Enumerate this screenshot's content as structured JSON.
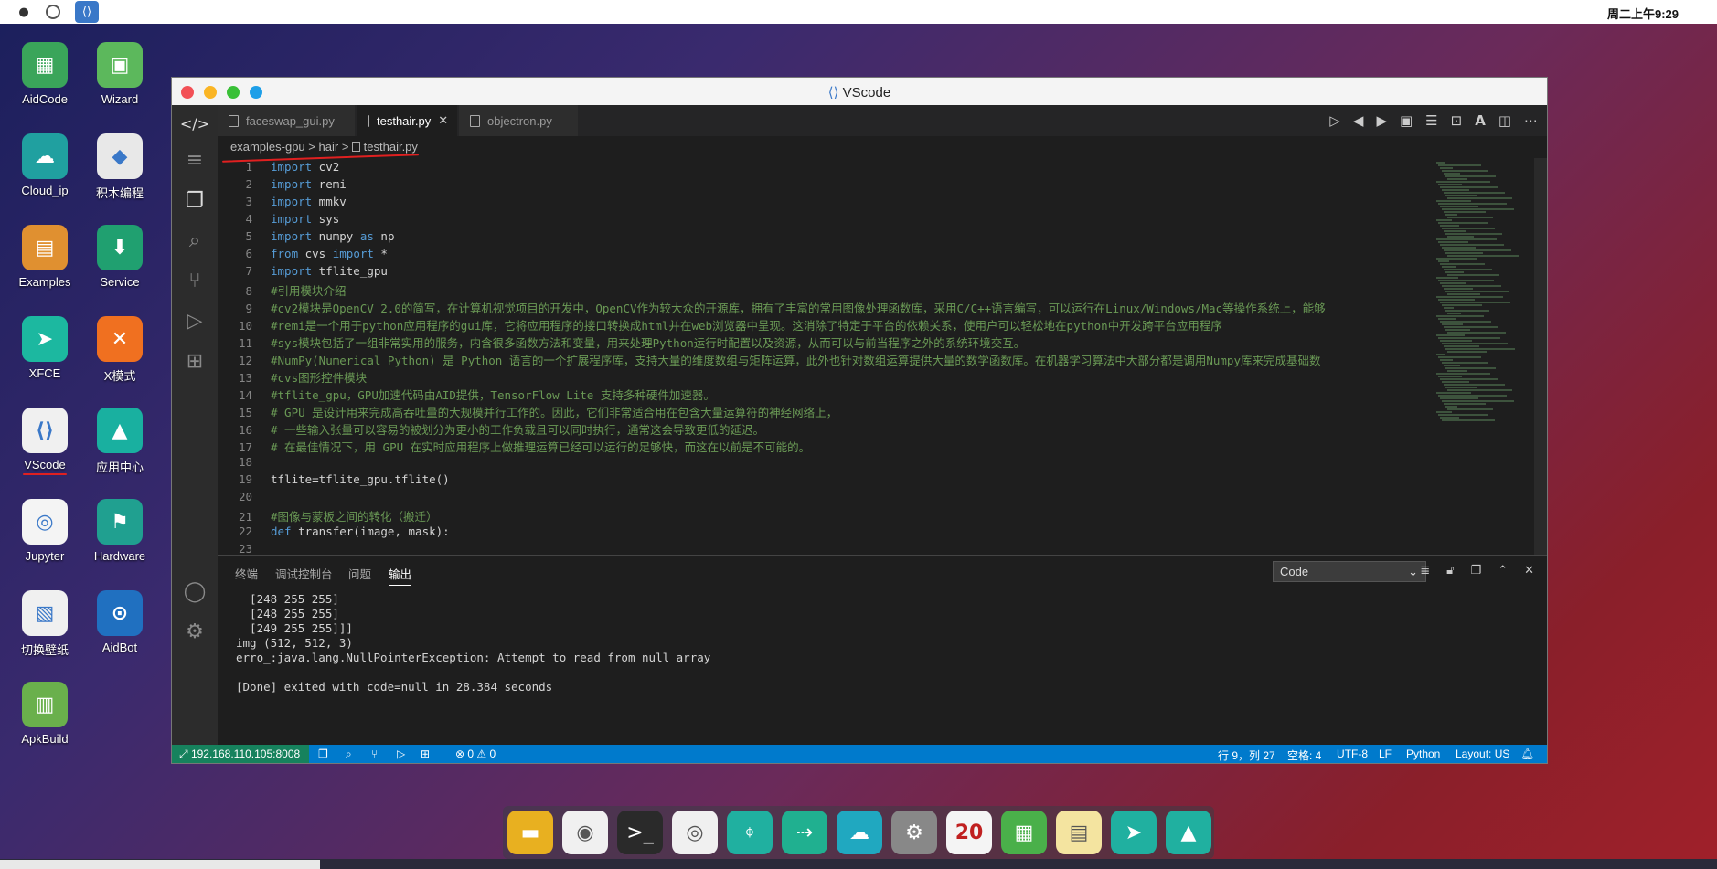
{
  "topbar": {
    "clock": "周二上午9:29"
  },
  "desktop": {
    "icons": [
      {
        "label": "AidCode",
        "color": "#3aa55a"
      },
      {
        "label": "Wizard",
        "color": "#5cb85c"
      },
      {
        "label": "Cloud_ip",
        "color": "#20a0a0"
      },
      {
        "label": "积木编程",
        "color": "#e8e8e8"
      },
      {
        "label": "Examples",
        "color": "#e09030"
      },
      {
        "label": "Service",
        "color": "#20a070"
      },
      {
        "label": "XFCE",
        "color": "#1cb8a0"
      },
      {
        "label": "X模式",
        "color": "#f07020"
      },
      {
        "label": "VScode",
        "color": "#f0f0f0"
      },
      {
        "label": "应用中心",
        "color": "#19b0a0"
      },
      {
        "label": "Jupyter",
        "color": "#f4f4f4"
      },
      {
        "label": "Hardware",
        "color": "#20a090"
      },
      {
        "label": "切换壁纸",
        "color": "#f0f0f0"
      },
      {
        "label": "AidBot",
        "color": "#2070c0"
      },
      {
        "label": "ApkBuild",
        "color": "#6ab04c"
      }
    ]
  },
  "window": {
    "title": "VScode",
    "tabs": [
      {
        "label": "faceswap_gui.py"
      },
      {
        "label": "testhair.py",
        "close": "✕"
      },
      {
        "label": "objectron.py"
      }
    ],
    "breadcrumb": {
      "part1": "examples-gpu",
      "sep": ">",
      "part2": "hair",
      "part3": "testhair.py"
    },
    "code": [
      {
        "n": "1",
        "kw": "import",
        "rest": " cv2"
      },
      {
        "n": "2",
        "kw": "import",
        "rest": " remi"
      },
      {
        "n": "3",
        "kw": "import",
        "rest": " mmkv"
      },
      {
        "n": "4",
        "kw": "import",
        "rest": " sys"
      },
      {
        "n": "5",
        "kw": "import",
        "rest": " numpy ",
        "kw2": "as",
        "rest2": " np"
      },
      {
        "n": "6",
        "kw": "from",
        "rest": " cvs ",
        "kw2": "import",
        "rest2": " *"
      },
      {
        "n": "7",
        "kw": "import",
        "rest": " tflite_gpu"
      },
      {
        "n": "8",
        "cm": "#引用模块介绍"
      },
      {
        "n": "9",
        "cm": "#cv2模块是OpenCV 2.0的简写，在计算机视觉项目的开发中，OpenCV作为较大众的开源库，拥有了丰富的常用图像处理函数库，采用C/C++语言编写，可以运行在Linux/Windows/Mac等操作系统上，能够"
      },
      {
        "n": "10",
        "cm": "#remi是一个用于python应用程序的gui库，它将应用程序的接口转换成html并在web浏览器中呈现。这消除了特定于平台的依赖关系，使用户可以轻松地在python中开发跨平台应用程序"
      },
      {
        "n": "11",
        "cm": "#sys模块包括了一组非常实用的服务，内含很多函数方法和变量，用来处理Python运行时配置以及资源，从而可以与前当程序之外的系统环境交互。"
      },
      {
        "n": "12",
        "cm": "#NumPy(Numerical Python) 是 Python 语言的一个扩展程序库，支持大量的维度数组与矩阵运算，此外也针对数组运算提供大量的数学函数库。在机器学习算法中大部分都是调用Numpy库来完成基础数"
      },
      {
        "n": "13",
        "cm": "#cvs图形控件模块"
      },
      {
        "n": "14",
        "cm": "#tflite_gpu，GPU加速代码由AID提供，TensorFlow Lite 支持多种硬件加速器。"
      },
      {
        "n": "15",
        "cm": "# GPU 是设计用来完成高吞吐量的大规模并行工作的。因此，它们非常适合用在包含大量运算符的神经网络上，"
      },
      {
        "n": "16",
        "cm": "# 一些输入张量可以容易的被划分为更小的工作负载且可以同时执行，通常这会导致更低的延迟。"
      },
      {
        "n": "17",
        "cm": "# 在最佳情况下，用 GPU 在实时应用程序上做推理运算已经可以运行的足够快，而这在以前是不可能的。"
      },
      {
        "n": "18",
        "tx": ""
      },
      {
        "n": "19",
        "tx": "tflite=tflite_gpu.tflite()"
      },
      {
        "n": "20",
        "tx": ""
      },
      {
        "n": "21",
        "cm": "#图像与蒙板之间的转化（搬迁）"
      },
      {
        "n": "22",
        "kw": "def",
        "rest": " transfer(image, mask):"
      },
      {
        "n": "23",
        "tx": ""
      }
    ],
    "panel": {
      "tabs": [
        {
          "label": "终端"
        },
        {
          "label": "调试控制台"
        },
        {
          "label": "问题"
        },
        {
          "label": "输出"
        }
      ],
      "select_value": "Code",
      "output": [
        "  [248 255 255]",
        "  [248 255 255]",
        "  [249 255 255]]]",
        "img (512, 512, 3)",
        "erro_:java.lang.NullPointerException: Attempt to read from null array",
        "",
        "[Done] exited with code=null in 28.384 seconds"
      ]
    },
    "statusbar": {
      "remote": "192.168.110.105:8008",
      "problems": "⊗ 0 ⚠ 0",
      "position": "行 9，列 27",
      "spaces": "空格: 4",
      "encoding": "UTF-8",
      "eol": "LF",
      "language": "Python",
      "layout": "Layout: US"
    }
  },
  "dock": {
    "items": [
      "files-icon",
      "game-icon",
      "terminal-icon",
      "browser-icon",
      "maps-icon",
      "export-icon",
      "cloud-icon",
      "settings-icon",
      "calendar-icon",
      "wizard-icon",
      "notes-icon",
      "xfce-icon",
      "appcenter-icon"
    ],
    "calendar_day": "20"
  },
  "colors": {
    "accent": "#007acc",
    "remote": "#16825d",
    "comment": "#6a9955",
    "keyword": "#569cd6"
  }
}
